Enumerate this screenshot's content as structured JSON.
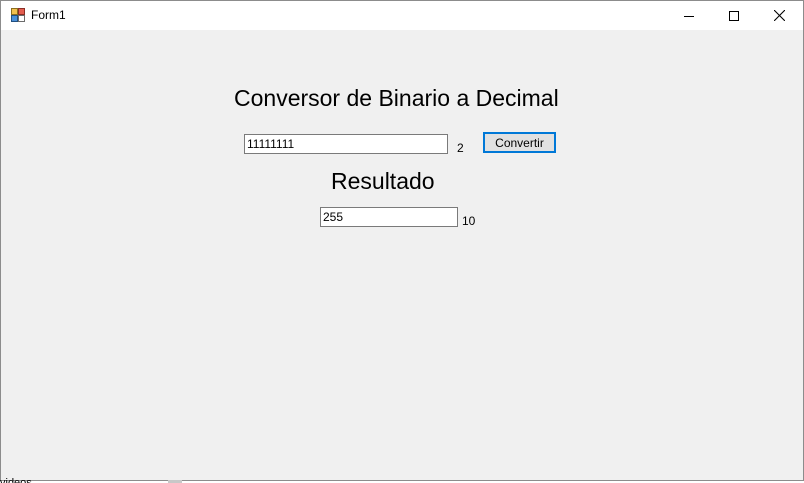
{
  "window": {
    "title": "Form1"
  },
  "titlebar_buttons": {
    "minimize_icon": "minimize-icon",
    "maximize_icon": "maximize-icon",
    "close_icon": "close-icon"
  },
  "form": {
    "heading": "Conversor de Binario a Decimal",
    "binary_input_value": "11111111",
    "binary_base_label": "2",
    "convert_button_label": "Convertir",
    "result_heading": "Resultado",
    "decimal_output_value": "255",
    "decimal_base_label": "10"
  },
  "background": {
    "partial_text": "videos"
  },
  "colors": {
    "form_background": "#f0f0f0",
    "titlebar_background": "#ffffff",
    "button_focus_border": "#0078d7",
    "button_background": "#e1e1e1"
  }
}
